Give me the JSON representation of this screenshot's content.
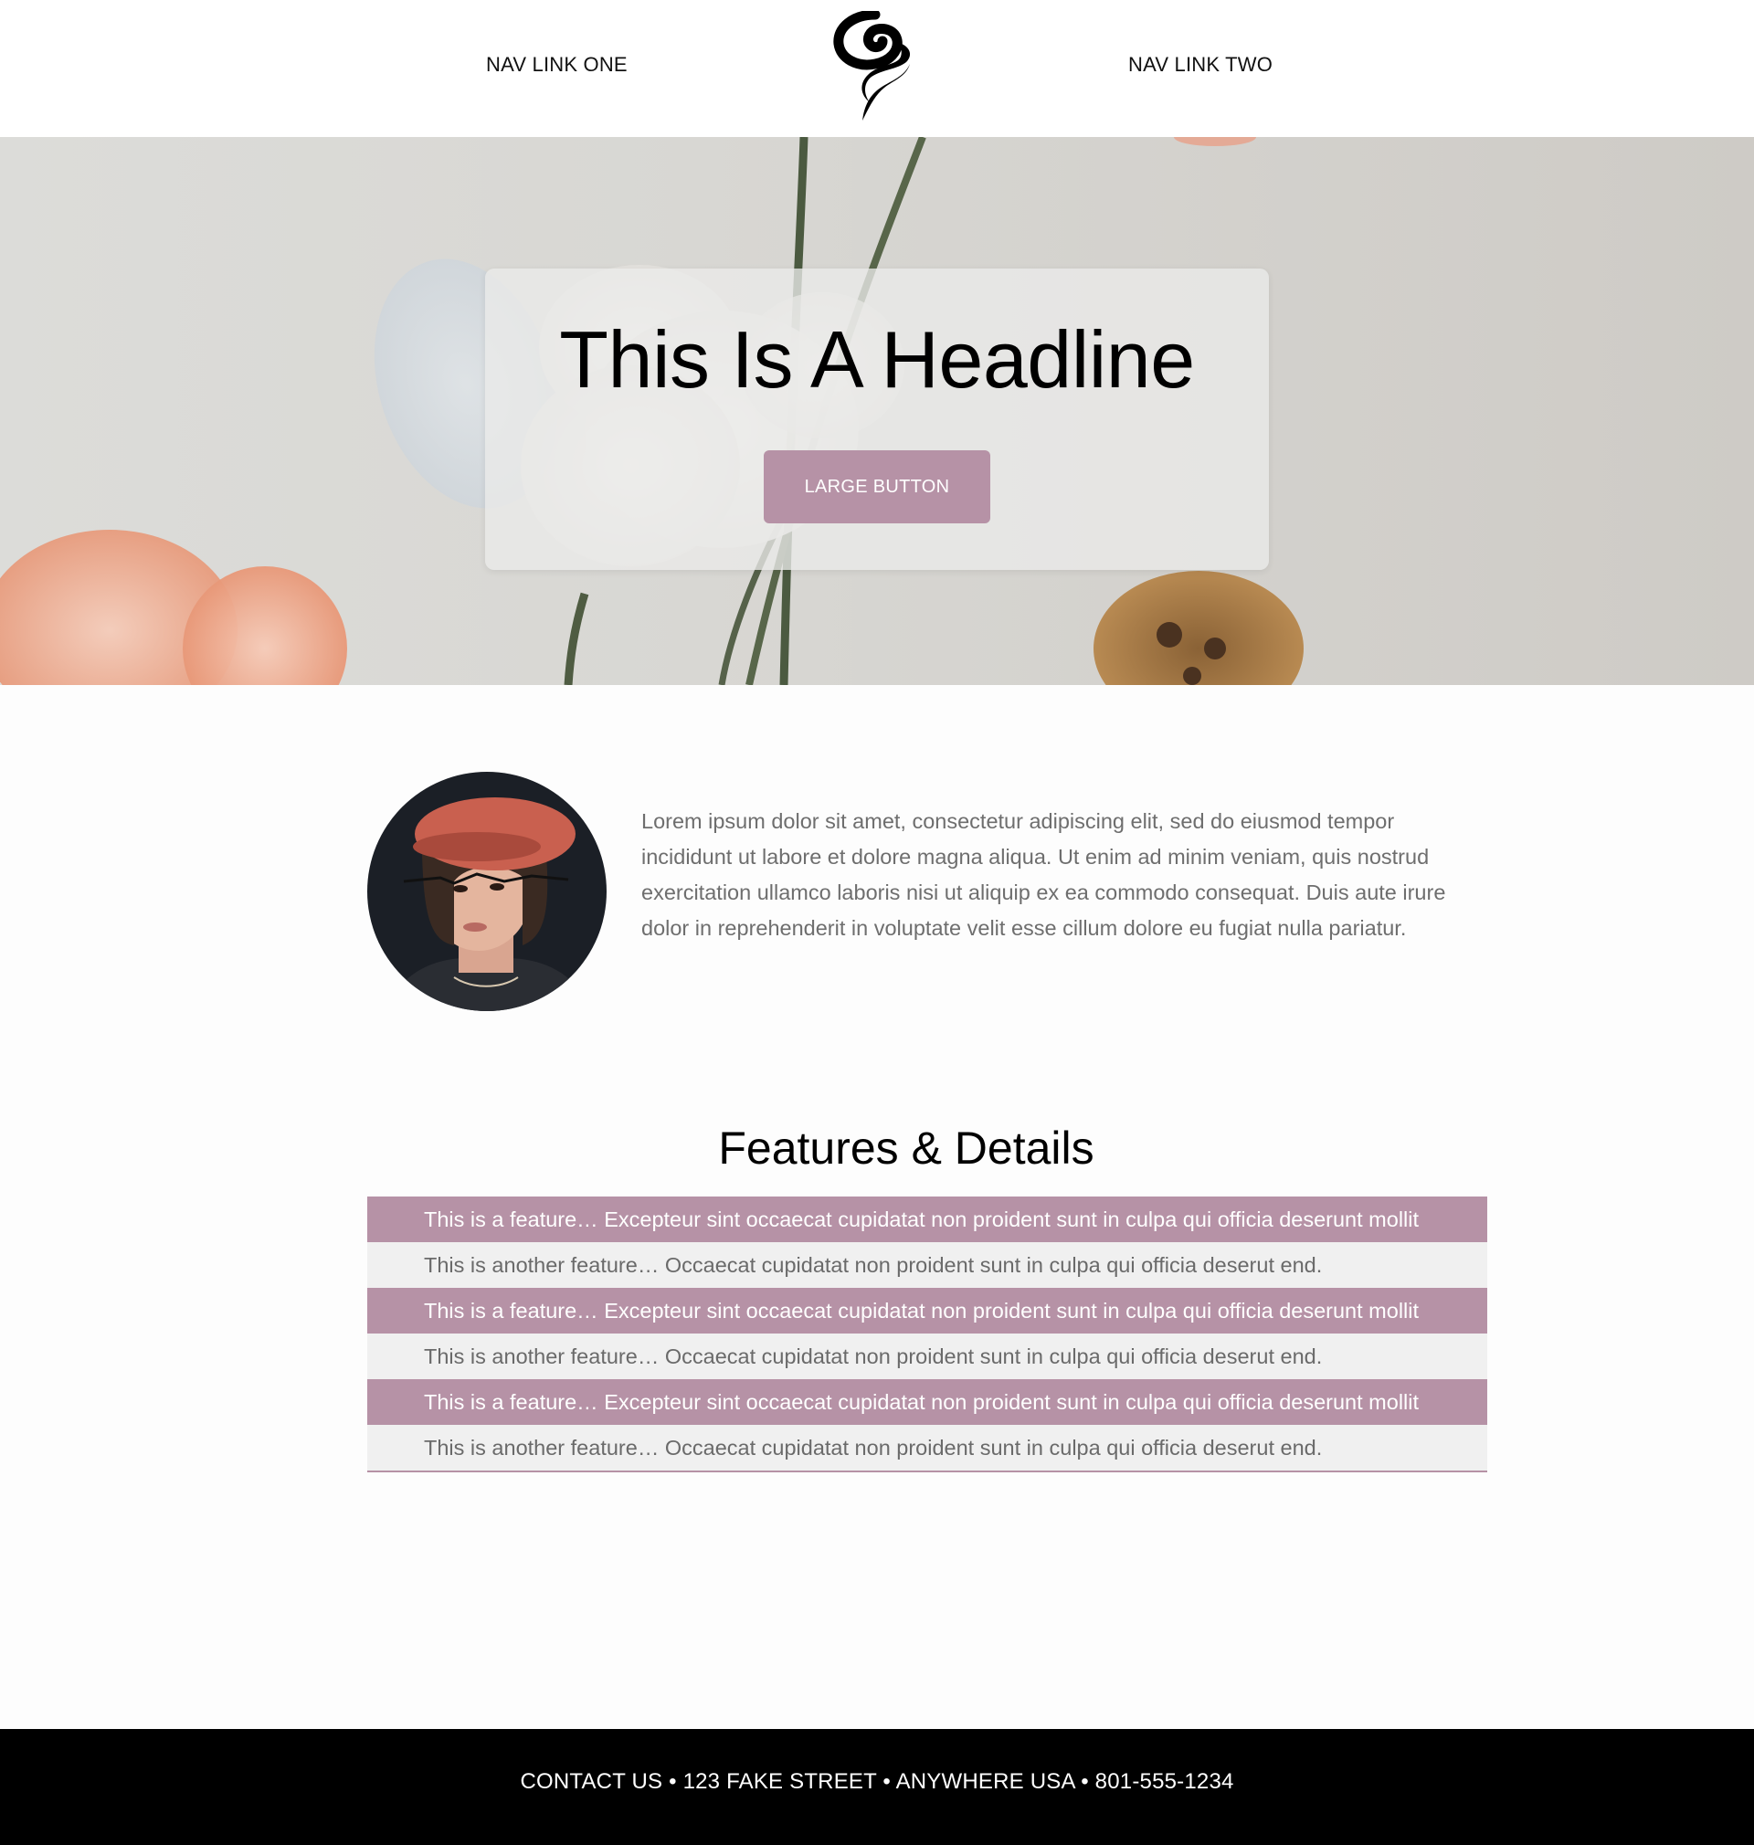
{
  "header": {
    "nav_link_one": "NAV LINK ONE",
    "nav_link_two": "NAV LINK TWO",
    "logo_icon": "swirl-logo-icon"
  },
  "hero": {
    "headline": "This Is A Headline",
    "button_label": "LARGE BUTTON"
  },
  "about": {
    "avatar_icon": "portrait-photo",
    "text": "Lorem ipsum dolor sit amet, consectetur adipiscing elit, sed do eiusmod tempor incididunt ut labore et dolore magna aliqua. Ut enim ad minim veniam, quis nostrud exercitation ullamco laboris nisi ut aliquip ex ea commodo consequat. Duis aute irure dolor in reprehenderit in voluptate velit esse cillum dolore eu fugiat nulla pariatur."
  },
  "features": {
    "heading": "Features & Details",
    "items": [
      {
        "text": "This is a feature… Excepteur sint occaecat cupidatat non proident sunt in culpa qui officia deserunt mollit",
        "style": "primary"
      },
      {
        "text": "This is another feature… Occaecat cupidatat non proident sunt in culpa qui officia deserut end.",
        "style": "secondary"
      },
      {
        "text": "This is a feature… Excepteur sint occaecat cupidatat non proident sunt in culpa qui officia deserunt mollit",
        "style": "primary"
      },
      {
        "text": "This is another feature… Occaecat cupidatat non proident sunt in culpa qui officia deserut end.",
        "style": "secondary"
      },
      {
        "text": "This is a feature… Excepteur sint occaecat cupidatat non proident sunt in culpa qui officia deserunt mollit",
        "style": "primary"
      },
      {
        "text": "This is another feature… Occaecat cupidatat non proident sunt in culpa qui officia deserut end.",
        "style": "secondary"
      }
    ]
  },
  "footer": {
    "text": "CONTACT US • 123 FAKE STREET • ANYWHERE USA • 801-555-1234"
  },
  "colors": {
    "accent": "#b692a6",
    "footer_bg": "#000000",
    "feature_alt_bg": "#f0f0f0",
    "body_text": "#6e6e6e"
  }
}
